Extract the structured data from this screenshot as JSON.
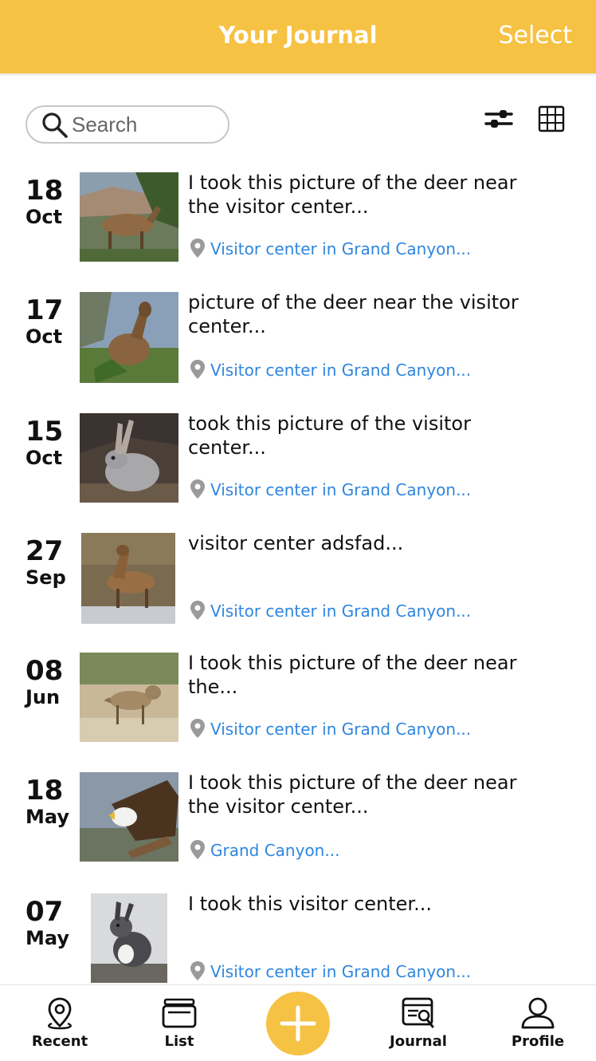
{
  "header": {
    "title": "Your Journal",
    "select_label": "Select"
  },
  "search": {
    "placeholder": "Search",
    "value": ""
  },
  "toolbar": {
    "filter_icon": "sliders-icon",
    "grid_icon": "grid-icon"
  },
  "entries": [
    {
      "day": "18",
      "month": "Oct",
      "text": "I took this picture of the deer near the visitor center...",
      "location": "Visitor center in Grand Canyon...",
      "image": "elk"
    },
    {
      "day": "17",
      "month": "Oct",
      "text": "picture of the deer near the visitor center...",
      "location": "Visitor center in Grand Canyon...",
      "image": "elk"
    },
    {
      "day": "15",
      "month": "Oct",
      "text": "took this picture of the visitor center...",
      "location": "Visitor center in Grand Canyon...",
      "image": "rabbit"
    },
    {
      "day": "27",
      "month": "Sep",
      "text": "visitor center adsfad...",
      "location": "Visitor center in Grand Canyon...",
      "image": "elk"
    },
    {
      "day": "08",
      "month": "Jun",
      "text": "I took this picture of the deer near the...",
      "location": "Visitor center in Grand Canyon...",
      "image": "coyote"
    },
    {
      "day": "18",
      "month": "May",
      "text": "I took this picture of the deer near the visitor center...",
      "location": "Grand Canyon...",
      "image": "eagle"
    },
    {
      "day": "07",
      "month": "May",
      "text": "I took this visitor center...",
      "location": "Visitor center in Grand Canyon...",
      "image": "squirrel"
    }
  ],
  "tabs": [
    {
      "label": "Recent",
      "icon": "location-pin-icon"
    },
    {
      "label": "List",
      "icon": "archive-box-icon"
    },
    {
      "label": "",
      "icon": "plus-icon"
    },
    {
      "label": "Journal",
      "icon": "journal-search-icon"
    },
    {
      "label": "Profile",
      "icon": "user-icon"
    }
  ],
  "colors": {
    "accent": "#f6c244",
    "link": "#2f86de"
  }
}
